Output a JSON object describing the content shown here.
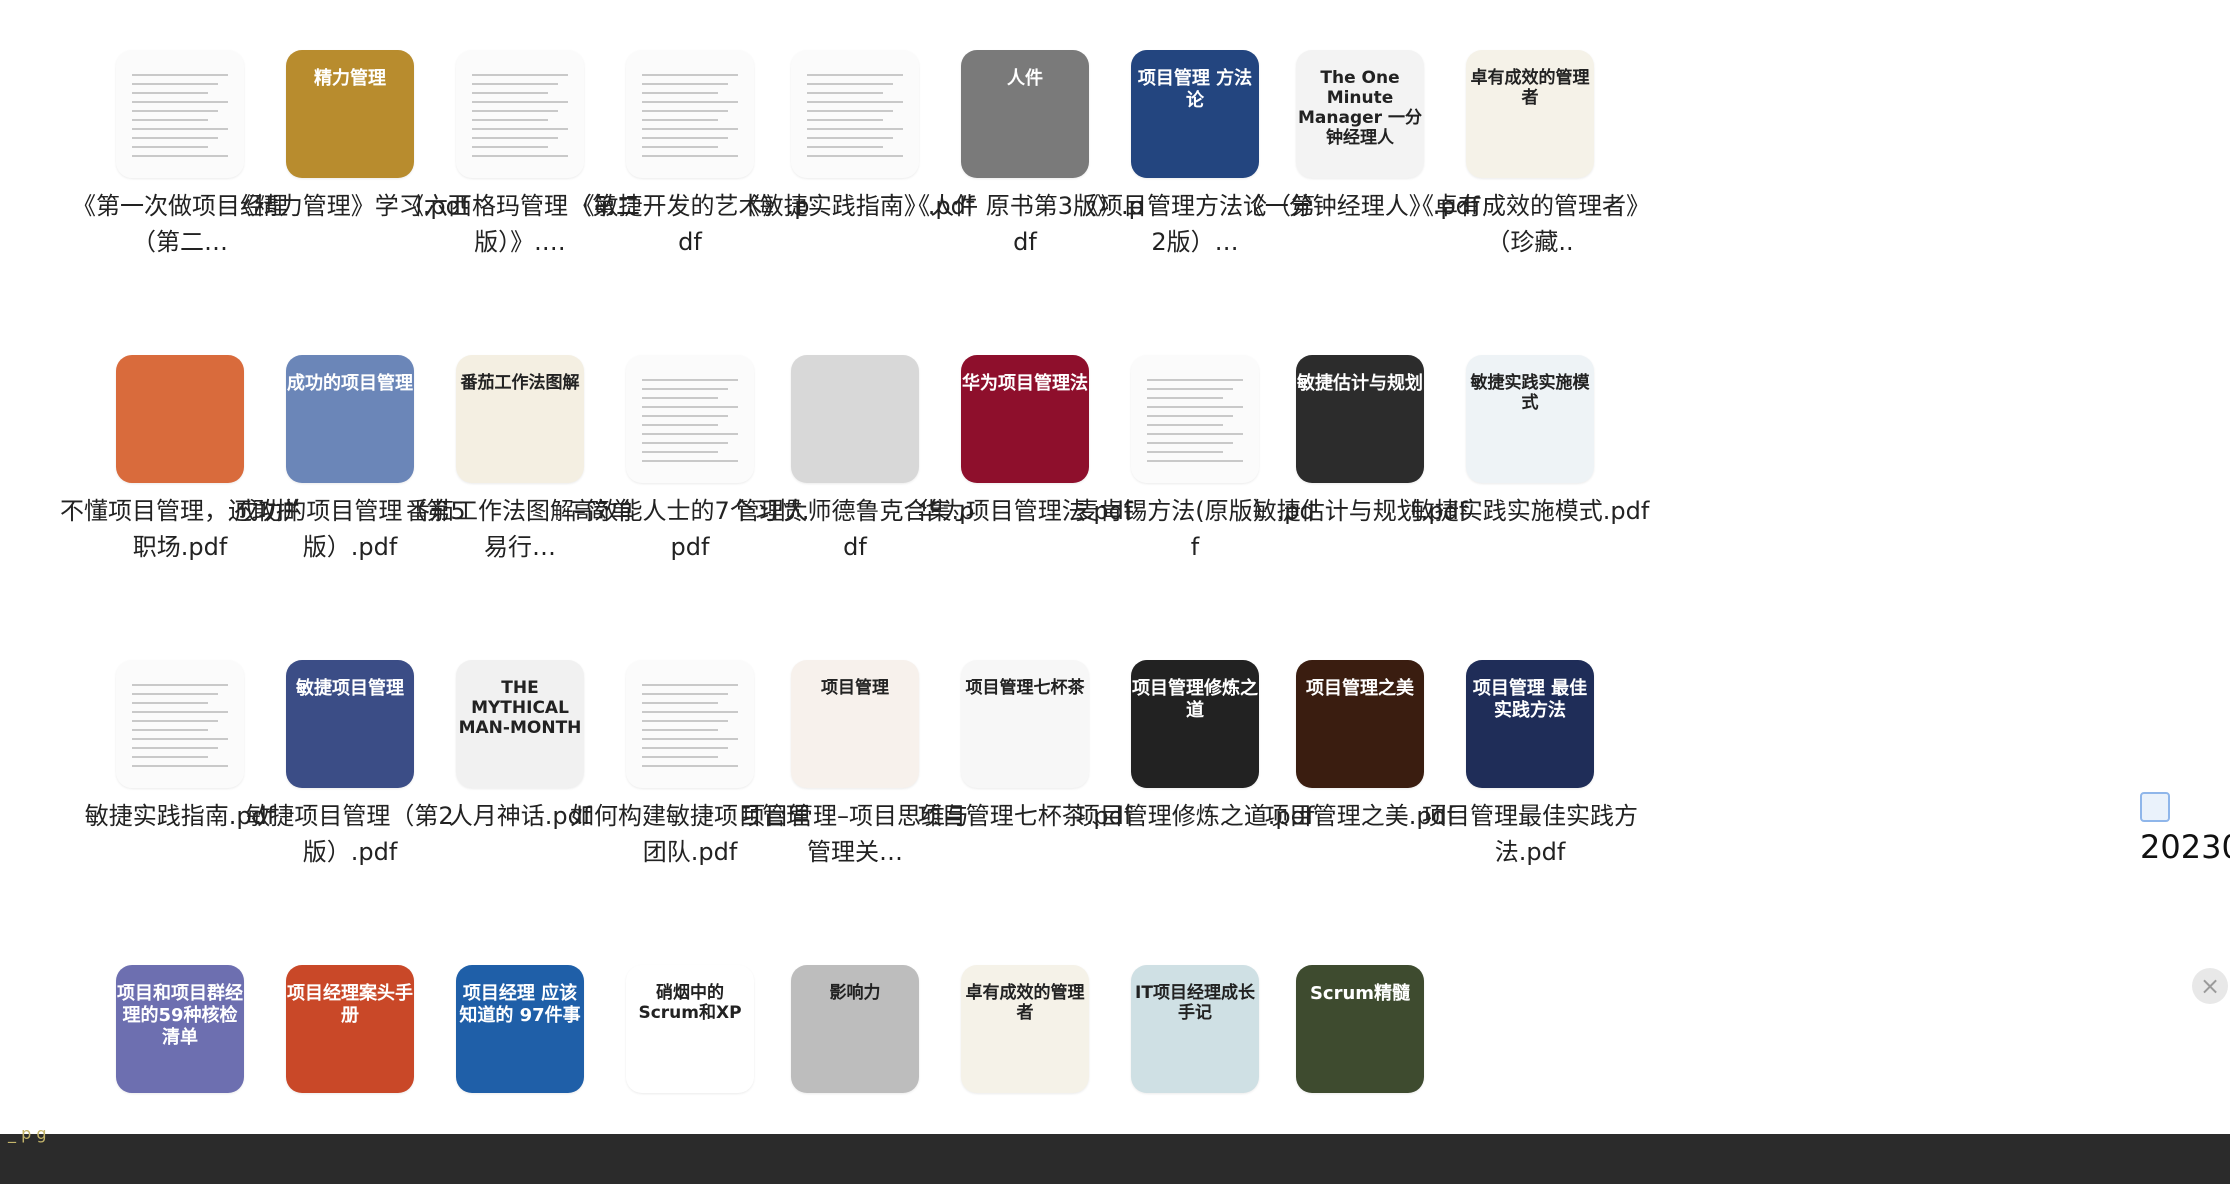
{
  "files": [
    {
      "label": "《第一次做项目经理 （第二…",
      "thumb": "doc"
    },
    {
      "label": "《精力管理》学习.pdf",
      "thumb": "cover",
      "color": "#b88c2e",
      "text": "精力管理"
    },
    {
      "label": "《六西格玛管理（第二版）》.…",
      "thumb": "doc"
    },
    {
      "label": "《敏捷开发的艺术》.pdf",
      "thumb": "doc"
    },
    {
      "label": "《敏捷实践指南》.pdf",
      "thumb": "doc"
    },
    {
      "label": "《人件 原书第3版》.pdf",
      "thumb": "cover",
      "color": "#7a7a7a",
      "text": "人件"
    },
    {
      "label": "《项目管理方法论（第2版）…",
      "thumb": "cover",
      "color": "#23457f",
      "text": "项目管理 方法论"
    },
    {
      "label": "《一分钟经理人》.pdf",
      "thumb": "cover",
      "color": "#f3f3f3",
      "text": "The One Minute Manager 一分钟经理人",
      "dark": true
    },
    {
      "label": "《卓有成效的管理者》（珍藏..",
      "thumb": "cover",
      "color": "#f5f2e8",
      "text": "卓有成效的管理者",
      "dark": true
    },
    {
      "label": "不懂项目管理，还敢拼职场.pdf",
      "thumb": "cover",
      "color": "#d96b3c",
      "text": ""
    },
    {
      "label": "成功的项目管理（第5版）.pdf",
      "thumb": "cover",
      "color": "#6b86b8",
      "text": "成功的项目管理"
    },
    {
      "label": "番茄工作法图解–简单易行…",
      "thumb": "cover",
      "color": "#f4efe2",
      "text": "番茄工作法图解",
      "dark": true
    },
    {
      "label": "高效能人士的7个习惯.pdf",
      "thumb": "doc"
    },
    {
      "label": "管理大师德鲁克合集.pdf",
      "thumb": "cover",
      "color": "#d8d8d8",
      "text": ""
    },
    {
      "label": "华为项目管理法.pdf",
      "thumb": "cover",
      "color": "#8e0f2c",
      "text": "华为项目管理法"
    },
    {
      "label": "麦肯锡方法(原版）.pdf",
      "thumb": "doc"
    },
    {
      "label": "敏捷估计与规划.pdf",
      "thumb": "cover",
      "color": "#2c2c2c",
      "text": "敏捷估计与规划"
    },
    {
      "label": "敏捷实践实施模式.pdf",
      "thumb": "cover",
      "color": "#eef3f6",
      "text": "敏捷实践实施模式",
      "dark": true
    },
    {
      "label": "敏捷实践指南.pdf",
      "thumb": "doc"
    },
    {
      "label": "敏捷项目管理（第2版）.pdf",
      "thumb": "cover",
      "color": "#3b4d86",
      "text": "敏捷项目管理"
    },
    {
      "label": "人月神话.pdf",
      "thumb": "cover",
      "color": "#f1f1f1",
      "text": "THE MYTHICAL MAN-MONTH",
      "dark": true
    },
    {
      "label": "如何构建敏捷项目管理团队.pdf",
      "thumb": "doc"
    },
    {
      "label": "项目管理–项目思维与管理关…",
      "thumb": "cover",
      "color": "#f7f1ec",
      "text": "项目管理",
      "dark": true
    },
    {
      "label": "项目管理七杯茶.pdf",
      "thumb": "cover",
      "color": "#f7f7f7",
      "text": "项目管理七杯茶",
      "dark": true
    },
    {
      "label": "项目管理修炼之道.pdf",
      "thumb": "cover",
      "color": "#222222",
      "text": "项目管理修炼之道"
    },
    {
      "label": "项目管理之美.pdf",
      "thumb": "cover",
      "color": "#3a1d10",
      "text": "项目管理之美"
    },
    {
      "label": "项目管理最佳实践方法.pdf",
      "thumb": "cover",
      "color": "#1f2d58",
      "text": "项目管理 最佳实践方法"
    },
    {
      "label": "",
      "thumb": "cover",
      "color": "#6d6fb0",
      "text": "项目和项目群经理的59种核检清单"
    },
    {
      "label": "",
      "thumb": "cover",
      "color": "#c94828",
      "text": "项目经理案头手册"
    },
    {
      "label": "",
      "thumb": "cover",
      "color": "#1f5fa8",
      "text": "项目经理 应该知道的 97件事"
    },
    {
      "label": "",
      "thumb": "cover",
      "color": "#ffffff",
      "text": "硝烟中的Scrum和XP",
      "dark": true
    },
    {
      "label": "",
      "thumb": "cover",
      "color": "#bdbdbd",
      "text": "影响力",
      "dark": true
    },
    {
      "label": "",
      "thumb": "cover",
      "color": "#f5f2e8",
      "text": "卓有成效的管理者",
      "dark": true
    },
    {
      "label": "",
      "thumb": "cover",
      "color": "#cfe0e4",
      "text": "IT项目经理成长手记",
      "dark": true
    },
    {
      "label": "",
      "thumb": "cover",
      "color": "#3e4b2f",
      "text": "Scrum精髓"
    }
  ],
  "overflow_text": "20230",
  "close_icon": "×"
}
